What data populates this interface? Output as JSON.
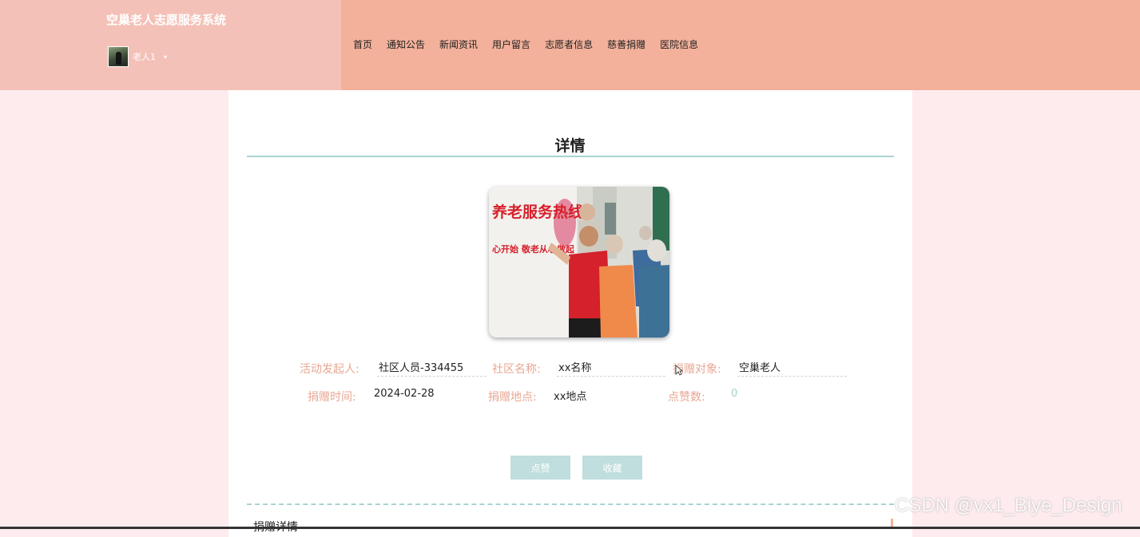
{
  "header": {
    "site_title": "空巢老人志愿服务系统",
    "user": {
      "name": "老人1",
      "caret": "▾"
    },
    "nav": [
      "首页",
      "通知公告",
      "新闻资讯",
      "用户留言",
      "志愿者信息",
      "慈善捐赠",
      "医院信息"
    ]
  },
  "detail": {
    "title": "详情",
    "photo_text": {
      "banner_line1": "养老服务热线",
      "banner_line2": "心开始  敬老从心做起"
    },
    "fields": {
      "initiator": {
        "label": "活动发起人:",
        "value": "社区人员-334455"
      },
      "community": {
        "label": "社区名称:",
        "value": "xx名称"
      },
      "target": {
        "label": "捐赠对象:",
        "value": "空巢老人"
      },
      "date": {
        "label": "捐赠时间:",
        "value": "2024-02-28"
      },
      "location": {
        "label": "捐赠地点:",
        "value": "xx地点"
      },
      "likes": {
        "label": "点赞数:",
        "value": "0"
      }
    },
    "buttons": {
      "like": "点赞",
      "favorite": "收藏"
    },
    "section_label": "捐赠详情"
  },
  "watermark": "CSDN @vx1_Biye_Design",
  "colors": {
    "header": "#f3b09a",
    "brand_panel": "#f4c1b8",
    "page_bg": "#fdebee",
    "label": "#e8a792",
    "accent": "#a9d3d2",
    "button": "#bfdedd"
  }
}
